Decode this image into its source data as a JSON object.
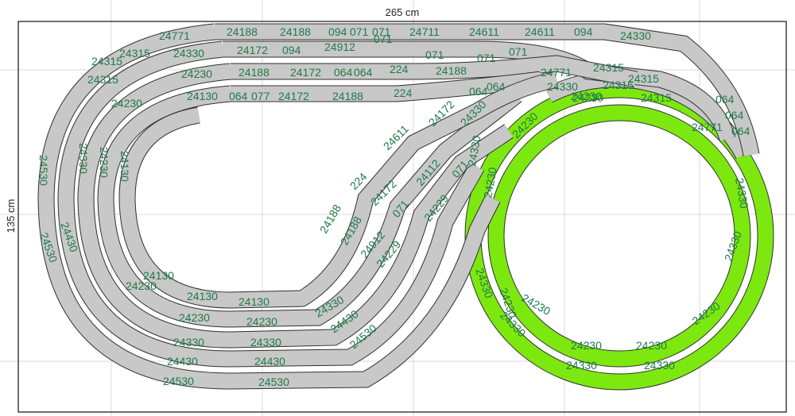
{
  "dimensions": {
    "width_label": "265 cm",
    "height_label": "135 cm"
  },
  "colors": {
    "track_gray": "#c8c8c8",
    "track_green": "#7de80f",
    "track_outline": "#303030",
    "grid": "#d9d9d9",
    "frame": "#111111",
    "label": "#1f7a4a"
  },
  "piece_labels": [
    "24771",
    "24188",
    "24188",
    "094",
    "071",
    "071",
    "24711",
    "24611",
    "24611",
    "094",
    "24330",
    "24315",
    "24315",
    "24315",
    "24172",
    "094",
    "24912",
    "071",
    "071",
    "071",
    "071",
    "24330",
    "24230",
    "24188",
    "24172",
    "064",
    "064",
    "224",
    "24188",
    "24230",
    "24130",
    "064",
    "077",
    "24172",
    "24188",
    "224",
    "064",
    "064",
    "24771",
    "24315",
    "24315",
    "24315",
    "24315",
    "24330",
    "24230",
    "24771",
    "064",
    "064",
    "064",
    "24530",
    "24530",
    "24430",
    "24330",
    "24230",
    "24130",
    "24611",
    "224",
    "24172",
    "24188",
    "24188",
    "24172",
    "24112",
    "071",
    "071",
    "24229",
    "24229",
    "24912",
    "24330",
    "24330",
    "24430",
    "24530",
    "24130",
    "24130",
    "24130",
    "24230",
    "24230",
    "24230",
    "24330",
    "24330",
    "24430",
    "24430",
    "24530",
    "24530",
    "24230",
    "24230",
    "24230",
    "24230",
    "24230",
    "24230",
    "24230",
    "24230",
    "24330",
    "24330",
    "24330",
    "24330",
    "24330",
    "24330",
    "24330"
  ]
}
